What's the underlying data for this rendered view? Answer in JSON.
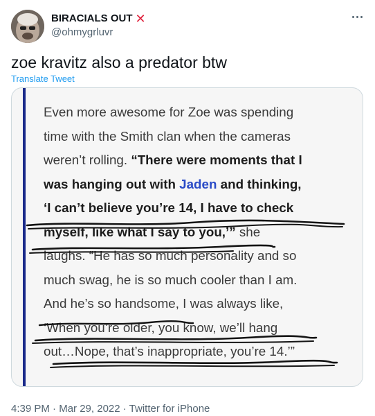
{
  "author": {
    "display_name": "BIRACIALS OUT",
    "name_emoji": "✕",
    "handle": "@ohmygrluvr"
  },
  "tweet": {
    "text": "zoe kravitz also a predator btw",
    "translate_label": "Translate Tweet"
  },
  "article": {
    "line1": "Even more awesome for Zoe was spending",
    "line2": "time with the Smith clan when the cameras",
    "line3_plain": "weren’t rolling. ",
    "line3_bold": "“There were moments that I",
    "line4_bold_a": "was hanging out with ",
    "line4_name": "Jaden",
    "line4_bold_b": " and thinking,",
    "line5_bold": "‘I can’t believe you’re 14, I have to check",
    "line6_bold": "myself, like what I say to you,’”",
    "line6_plain": " she",
    "line7": "laughs. “He has so much personality and so",
    "line8": "much swag, he is so much cooler than I am.",
    "line9": "And he’s so handsome, I was always like,",
    "line10": "‘When you’re older, you know, we’ll hang",
    "line11": "out…Nope, that’s inappropriate, you’re 14.’”"
  },
  "meta": {
    "time": "4:39 PM",
    "separator1": " · ",
    "date": "Mar 29, 2022",
    "separator2": " · ",
    "source": "Twitter for iPhone"
  },
  "colors": {
    "link": "#1d9bf0",
    "quote_bar": "#1a2a8a",
    "name_highlight": "#2a4bc7",
    "secondary_text": "#536471"
  },
  "icons": [
    "more-options-icon",
    "red-x-emoji"
  ]
}
